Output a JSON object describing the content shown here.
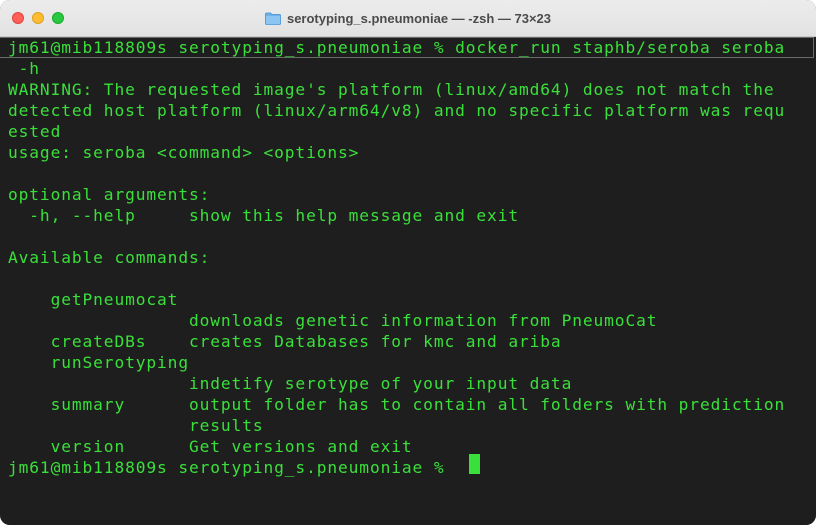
{
  "window": {
    "title": "serotyping_s.pneumoniae — -zsh — 73×23"
  },
  "terminal": {
    "lines": [
      "jm61@mib118809s serotyping_s.pneumoniae % docker_run staphb/seroba seroba",
      " -h",
      "WARNING: The requested image's platform (linux/amd64) does not match the",
      "detected host platform (linux/arm64/v8) and no specific platform was requ",
      "ested",
      "usage: seroba <command> <options>",
      "",
      "optional arguments:",
      "  -h, --help     show this help message and exit",
      "",
      "Available commands:",
      "",
      "    getPneumocat",
      "                 downloads genetic information from PneumoCat",
      "    createDBs    creates Databases for kmc and ariba",
      "    runSerotyping",
      "                 indetify serotype of your input data",
      "    summary      output folder has to contain all folders with prediction",
      "                 results",
      "    version      Get versions and exit",
      "jm61@mib118809s serotyping_s.pneumoniae % "
    ]
  },
  "colors": {
    "terminal_bg": "#1e1e1e",
    "terminal_fg": "#3ae03a",
    "titlebar_bg": "#e6e6e6"
  }
}
